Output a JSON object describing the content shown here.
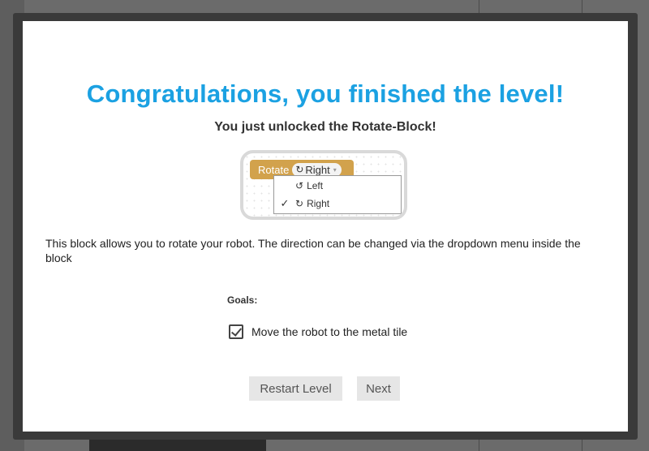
{
  "modal": {
    "title": "Congratulations, you finished the level!",
    "subtitle": "You just unlocked the Rotate-Block!",
    "block_preview": {
      "block_label": "Rotate",
      "selected_value": "Right",
      "selected_glyph": "↻",
      "caret": "▾",
      "options": [
        {
          "label": "Left",
          "glyph": "↺",
          "checked": false
        },
        {
          "label": "Right",
          "glyph": "↻",
          "checked": true
        }
      ],
      "check_mark": "✓",
      "block_color": "#d2a24c"
    },
    "description": "This block allows you to rotate your robot. The direction can be changed via the dropdown menu inside the block",
    "goals": {
      "label": "Goals:",
      "items": [
        {
          "text": "Move the robot to the metal tile",
          "checked": true
        }
      ]
    },
    "buttons": {
      "restart_label": "Restart Level",
      "next_label": "Next"
    }
  },
  "colors": {
    "title": "#1ba1e2",
    "button_bg": "#e6e6e6",
    "backdrop": "#6b6b6b"
  }
}
